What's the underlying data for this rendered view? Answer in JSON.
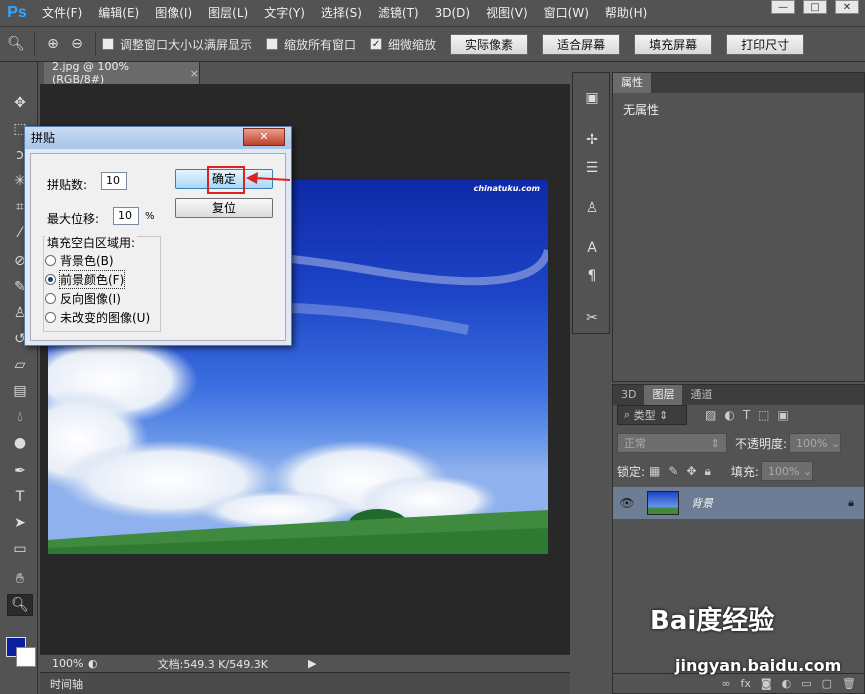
{
  "app": {
    "logo": "Ps",
    "menu": [
      "文件(F)",
      "编辑(E)",
      "图像(I)",
      "图层(L)",
      "文字(Y)",
      "选择(S)",
      "滤镜(T)",
      "3D(D)",
      "视图(V)",
      "窗口(W)",
      "帮助(H)"
    ],
    "window_controls": [
      "—",
      "□",
      "✕"
    ]
  },
  "options_bar": {
    "checkboxes": [
      {
        "label": "调整窗口大小以满屏显示",
        "checked": false
      },
      {
        "label": "缩放所有窗口",
        "checked": false
      },
      {
        "label": "细微缩放",
        "checked": true
      }
    ],
    "buttons": [
      "实际像素",
      "适合屏幕",
      "填充屏幕",
      "打印尺寸"
    ]
  },
  "document": {
    "tab_title": "2.jpg @ 100%(RGB/8#)",
    "tab_close": "×",
    "photo_watermark": "chinatuku.com",
    "zoom": "100%",
    "doc_info": "文档:549.3 K/549.3K",
    "timeline_label": "时间轴"
  },
  "properties_panel": {
    "tab": "属性",
    "content": "无属性"
  },
  "layers_panel": {
    "tabs": [
      "3D",
      "图层",
      "通道"
    ],
    "active_tab": "图层",
    "filter_label": "类型",
    "blend_mode": "正常",
    "opacity_label": "不透明度:",
    "opacity_value": "100%",
    "lock_label": "锁定:",
    "fill_label": "填充:",
    "fill_value": "100%",
    "layers": [
      {
        "name": "背景",
        "locked": true,
        "visible": true
      }
    ]
  },
  "dialog": {
    "title": "拼贴",
    "close_label": "✕",
    "tile_count_label": "拼贴数:",
    "tile_count_value": "10",
    "max_offset_label": "最大位移:",
    "max_offset_value": "10",
    "max_offset_unit": "%",
    "ok_label": "确定",
    "reset_label": "复位",
    "fill_group_label": "填充空白区域用:",
    "fill_options": [
      {
        "label": "背景色(B)",
        "selected": false
      },
      {
        "label": "前景颜色(F)",
        "selected": true
      },
      {
        "label": "反向图像(I)",
        "selected": false
      },
      {
        "label": "未改变的图像(U)",
        "selected": false
      }
    ]
  },
  "watermark": {
    "brand": "Bai度经验",
    "url": "jingyan.baidu.com"
  },
  "colors": {
    "foreground": "#0a1e9e",
    "background": "#ffffff",
    "highlight": "#e02020"
  }
}
